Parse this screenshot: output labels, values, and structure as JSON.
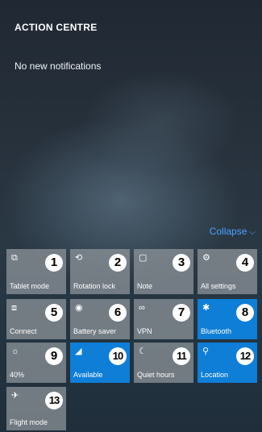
{
  "header": {
    "title": "ACTION CENTRE"
  },
  "notifications": {
    "empty_text": "No new notifications"
  },
  "collapse": {
    "label": "Collapse",
    "chevron": "⌵"
  },
  "colors": {
    "accent": "#0F7ED6",
    "tile_inactive": "#8E949A",
    "link": "#4AA3FF"
  },
  "tiles": [
    {
      "label": "Tablet mode",
      "number": "1",
      "icon": "tablet-mode-icon",
      "glyph": "⧉",
      "active": false
    },
    {
      "label": "Rotation lock",
      "number": "2",
      "icon": "rotation-lock-icon",
      "glyph": "⟲",
      "active": false
    },
    {
      "label": "Note",
      "number": "3",
      "icon": "note-icon",
      "glyph": "▢",
      "active": false
    },
    {
      "label": "All settings",
      "number": "4",
      "icon": "gear-icon",
      "glyph": "⚙",
      "active": false
    },
    {
      "label": "Connect",
      "number": "5",
      "icon": "connect-icon",
      "glyph": "⧈",
      "active": false
    },
    {
      "label": "Battery saver",
      "number": "6",
      "icon": "battery-saver-icon",
      "glyph": "◉",
      "active": false
    },
    {
      "label": "VPN",
      "number": "7",
      "icon": "vpn-icon",
      "glyph": "∞",
      "active": false
    },
    {
      "label": "Bluetooth",
      "number": "8",
      "icon": "bluetooth-icon",
      "glyph": "✱",
      "active": true
    },
    {
      "label": "40%",
      "number": "9",
      "icon": "brightness-icon",
      "glyph": "☼",
      "active": false
    },
    {
      "label": "Available",
      "number": "10",
      "icon": "wifi-icon",
      "glyph": "◢",
      "active": true
    },
    {
      "label": "Quiet hours",
      "number": "11",
      "icon": "moon-icon",
      "glyph": "☾",
      "active": false
    },
    {
      "label": "Location",
      "number": "12",
      "icon": "location-icon",
      "glyph": "⚲",
      "active": true
    },
    {
      "label": "Flight mode",
      "number": "13",
      "icon": "airplane-icon",
      "glyph": "✈",
      "active": false
    }
  ]
}
